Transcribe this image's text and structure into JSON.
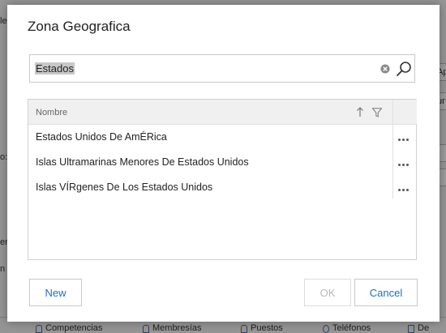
{
  "background": {
    "frag_le": "le",
    "frag_ap": "Ap",
    "frag_ur": "ur",
    "frag_colon": "o:*",
    "frag_en": "en",
    "frag_n": "n",
    "tabs": [
      "Competencias",
      "Membresías",
      "Puestos",
      "Teléfonos",
      "De"
    ]
  },
  "dialog": {
    "title": "Zona Geografica",
    "search": {
      "value": "Estados"
    },
    "grid": {
      "column_header": "Nombre",
      "rows": [
        "Estados Unidos De AmÉRica",
        "Islas Ultramarinas Menores De Estados Unidos",
        "Islas VÍRgenes De Los Estados Unidos"
      ]
    },
    "buttons": {
      "new": "New",
      "ok": "OK",
      "cancel": "Cancel"
    }
  },
  "icons": {
    "clear": "clear-circle-icon",
    "search": "magnifier-icon",
    "sort": "arrow-up-icon",
    "filter": "funnel-icon",
    "more": "ellipsis-icon"
  },
  "colors": {
    "accent": "#1a6fc4",
    "selection": "#c8c8c8",
    "header_bg": "#f0f0f0"
  }
}
